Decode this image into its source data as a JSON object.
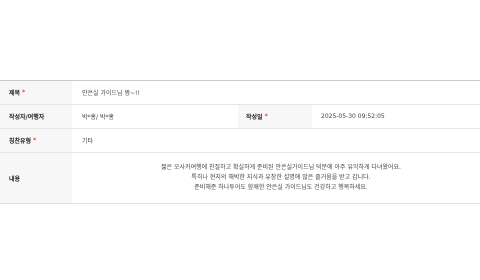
{
  "form": {
    "title": {
      "label": "제목",
      "required_mark": "*",
      "value": "안은실 가이드님 짱~!!"
    },
    "author": {
      "label": "작성자/여행자",
      "value": "박*홍/ 박*홍"
    },
    "written_date": {
      "label": "작성일",
      "required_mark": "*",
      "value": "2025-05-30 09:52:05"
    },
    "praise_type": {
      "label": "칭찬유형",
      "required_mark": "*",
      "value": "기타"
    },
    "content": {
      "label": "내용",
      "lines": [
        "짧은 오사카여행에 친절하고 확실하게 준비된 안은실가이드님 덕분에 아주 유익하게 다녀왔어요.",
        "특히나 현지의 해박한 지식과 유창한 설명에 많은 즐거움을 받고 갑니다.",
        "준비해준 하나투어도 함께한 안은실 가이드님도 건강하고 행복하세요."
      ]
    }
  }
}
